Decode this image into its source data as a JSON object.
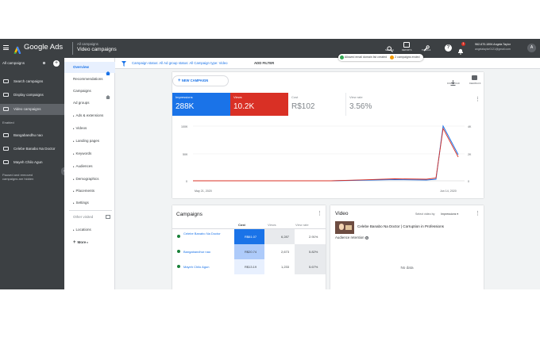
{
  "topbar": {
    "app_name": "Google Ads",
    "breadcrumb_parent": "All campaigns",
    "breadcrumb_current": "Video campaigns",
    "tool_search": "SEARCH",
    "tool_reports": "REPORTS",
    "tool_tools": "TOOLS &",
    "account_line1": "962-670-1894 Angela Taylor",
    "account_line2": "angelataylor0121@gmail.com",
    "avatar": "A",
    "notification_count": "1"
  },
  "toasts": {
    "first": "Allowed email domain list created",
    "second": "2 campaigns ended"
  },
  "leftpanel": {
    "header": "All campaigns",
    "items": [
      {
        "label": "Search campaigns"
      },
      {
        "label": "Display campaigns"
      },
      {
        "label": "Video campaigns"
      }
    ],
    "enabled_heading": "Enabled",
    "campaigns": [
      {
        "label": "Bangabandhu nao"
      },
      {
        "label": "Celebe Banabo Na Doctor"
      },
      {
        "label": "Mayeh Chilo Agun"
      }
    ],
    "footer_note": "Paused and removed campaigns are hidden"
  },
  "nav": {
    "items": [
      {
        "label": "Overview"
      },
      {
        "label": "Recommendations"
      },
      {
        "label": "Campaigns"
      },
      {
        "label": "Ad groups"
      },
      {
        "label": "Ads & extensions"
      },
      {
        "label": "Videos"
      },
      {
        "label": "Landing pages"
      },
      {
        "label": "Keywords"
      },
      {
        "label": "Audiences"
      },
      {
        "label": "Demographics"
      },
      {
        "label": "Placements"
      },
      {
        "label": "Settings"
      },
      {
        "label": "Other visited"
      },
      {
        "label": "Locations"
      },
      {
        "label": "More"
      }
    ]
  },
  "filterbar": {
    "text": "Campaign status: All  Ad group status: All  Campaign type: Video",
    "add_filter": "ADD FILTER"
  },
  "overview": {
    "new_campaign": "NEW CAMPAIGN",
    "download": "DOWNLOAD",
    "feedback": "FEEDBACK",
    "metrics": [
      {
        "label": "Impressions",
        "value": "288K",
        "color": "#1a73e8"
      },
      {
        "label": "Views",
        "value": "10.2K",
        "color": "#d93025"
      },
      {
        "label": "Cost",
        "value": "R$102"
      },
      {
        "label": "View rate",
        "value": "3.56%"
      }
    ],
    "y_left_ticks": [
      "100K",
      "50K",
      "0"
    ],
    "y_right_ticks": [
      "4K",
      "2K",
      "0"
    ],
    "x_start": "May 21, 2020",
    "x_end": "Jun 14, 2020"
  },
  "chart_data": {
    "type": "line",
    "x": [
      "May 21, 2020",
      "Jun 14, 2020"
    ],
    "series": [
      {
        "name": "Impressions",
        "color": "#1a73e8"
      },
      {
        "name": "Views",
        "color": "#d93025"
      }
    ],
    "y_left_ticks": [
      "100K",
      "50K",
      "0"
    ],
    "y_right_ticks": [
      "4K",
      "2K",
      "0"
    ]
  },
  "campaigns_card": {
    "title": "Campaigns",
    "columns": [
      "Cost",
      "Views",
      "View rate"
    ],
    "rows": [
      {
        "name": "Celebe Banabo Na Doctor",
        "cost": "R$61.07",
        "views": "6,287",
        "rate": "2.91%"
      },
      {
        "name": "Bangabandhur nao",
        "cost": "R$20.74",
        "views": "2,673",
        "rate": "5.82%"
      },
      {
        "name": "Mayeh Chilo Agun",
        "cost": "R$13.19",
        "views": "1,233",
        "rate": "5.67%"
      }
    ]
  },
  "video_card": {
    "title": "Video",
    "select_by": "Select video by",
    "select_value": "Impressions",
    "video_title": "Celebe Banabo Na Doctor | Corruption in Professions",
    "retention": "Audience retention",
    "no_data": "No data"
  }
}
